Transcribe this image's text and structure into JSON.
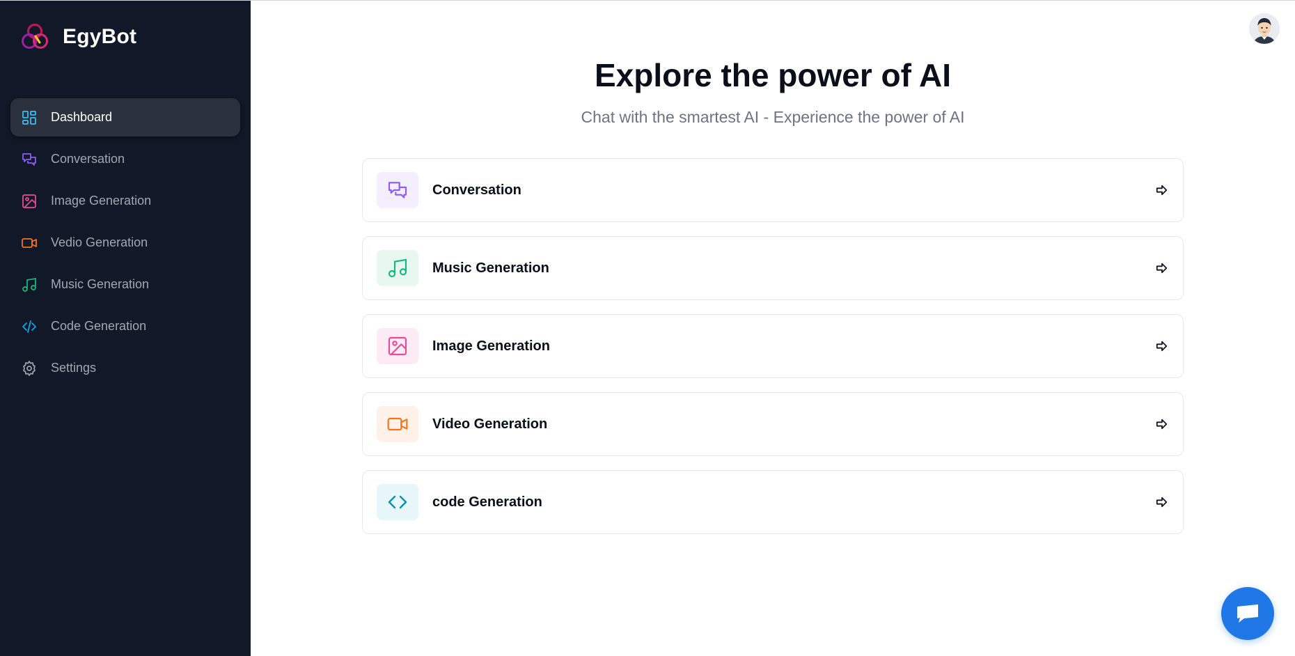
{
  "brand": {
    "name": "EgyBot"
  },
  "sidebar": {
    "items": [
      {
        "label": "Dashboard",
        "icon": "dashboard-icon",
        "color": "#38bdf8",
        "active": true
      },
      {
        "label": "Conversation",
        "icon": "chat-icon",
        "color": "#8b5cf6"
      },
      {
        "label": "Image Generation",
        "icon": "image-icon",
        "color": "#ec4899"
      },
      {
        "label": "Vedio Generation",
        "icon": "video-icon",
        "color": "#f97316"
      },
      {
        "label": "Music Generation",
        "icon": "music-icon",
        "color": "#10b981"
      },
      {
        "label": "Code Generation",
        "icon": "code-icon",
        "color": "#0ea5e9"
      },
      {
        "label": "Settings",
        "icon": "gear-icon",
        "color": "#9ca3af"
      }
    ]
  },
  "main": {
    "title": "Explore the power of AI",
    "subtitle": "Chat with the smartest AI - Experience the power of AI",
    "cards": [
      {
        "label": "Conversation",
        "icon": "chat-icon",
        "color": "#8b5cf6",
        "bg": "#f3effe"
      },
      {
        "label": "Music Generation",
        "icon": "music-icon",
        "color": "#10b981",
        "bg": "#e8f8f0"
      },
      {
        "label": "Image Generation",
        "icon": "image-icon",
        "color": "#ec4899",
        "bg": "#fdebf3"
      },
      {
        "label": "Video Generation",
        "icon": "video-icon",
        "color": "#f97316",
        "bg": "#fef1e7"
      },
      {
        "label": "code Generation",
        "icon": "code-icon",
        "color": "#0891b2",
        "bg": "#e6f6f9"
      }
    ]
  },
  "colors": {
    "sidebar_bg": "#111827",
    "active_bg": "#2a303c",
    "fab": "#1f78e6"
  }
}
